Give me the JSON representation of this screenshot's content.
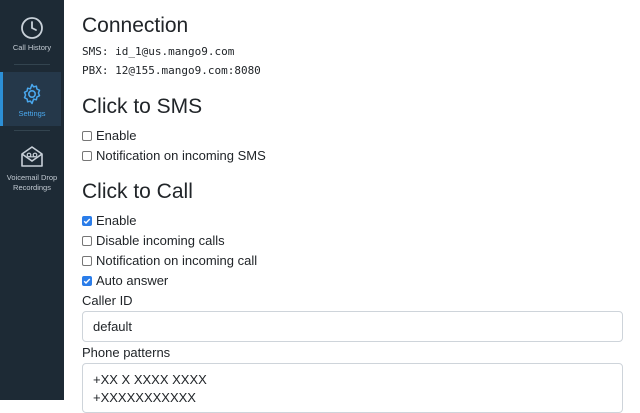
{
  "sidebar": {
    "items": [
      {
        "label": "Call History",
        "icon": "clock-icon",
        "active": false
      },
      {
        "label": "Settings",
        "icon": "gear-icon",
        "active": true
      },
      {
        "label": "Voicemail Drop Recordings",
        "icon": "voicemail-drop-icon",
        "active": false
      }
    ]
  },
  "connection": {
    "title": "Connection",
    "sms": "SMS: id_1@us.mango9.com",
    "pbx": "PBX: 12@155.mango9.com:8080"
  },
  "click_to_sms": {
    "title": "Click to SMS",
    "options": [
      {
        "label": "Enable",
        "checked": false
      },
      {
        "label": "Notification on incoming SMS",
        "checked": false
      }
    ]
  },
  "click_to_call": {
    "title": "Click to Call",
    "options": [
      {
        "label": "Enable",
        "checked": true
      },
      {
        "label": "Disable incoming calls",
        "checked": false
      },
      {
        "label": "Notification on incoming call",
        "checked": false
      },
      {
        "label": "Auto answer",
        "checked": true
      }
    ],
    "caller_id_label": "Caller ID",
    "caller_id_value": "default",
    "phone_patterns_label": "Phone patterns",
    "phone_patterns": [
      "+XX X XXXX XXXX",
      "+XXXXXXXXXXX"
    ]
  },
  "colors": {
    "sidebar_bg": "#1d2a35",
    "accent": "#2b7de9"
  }
}
